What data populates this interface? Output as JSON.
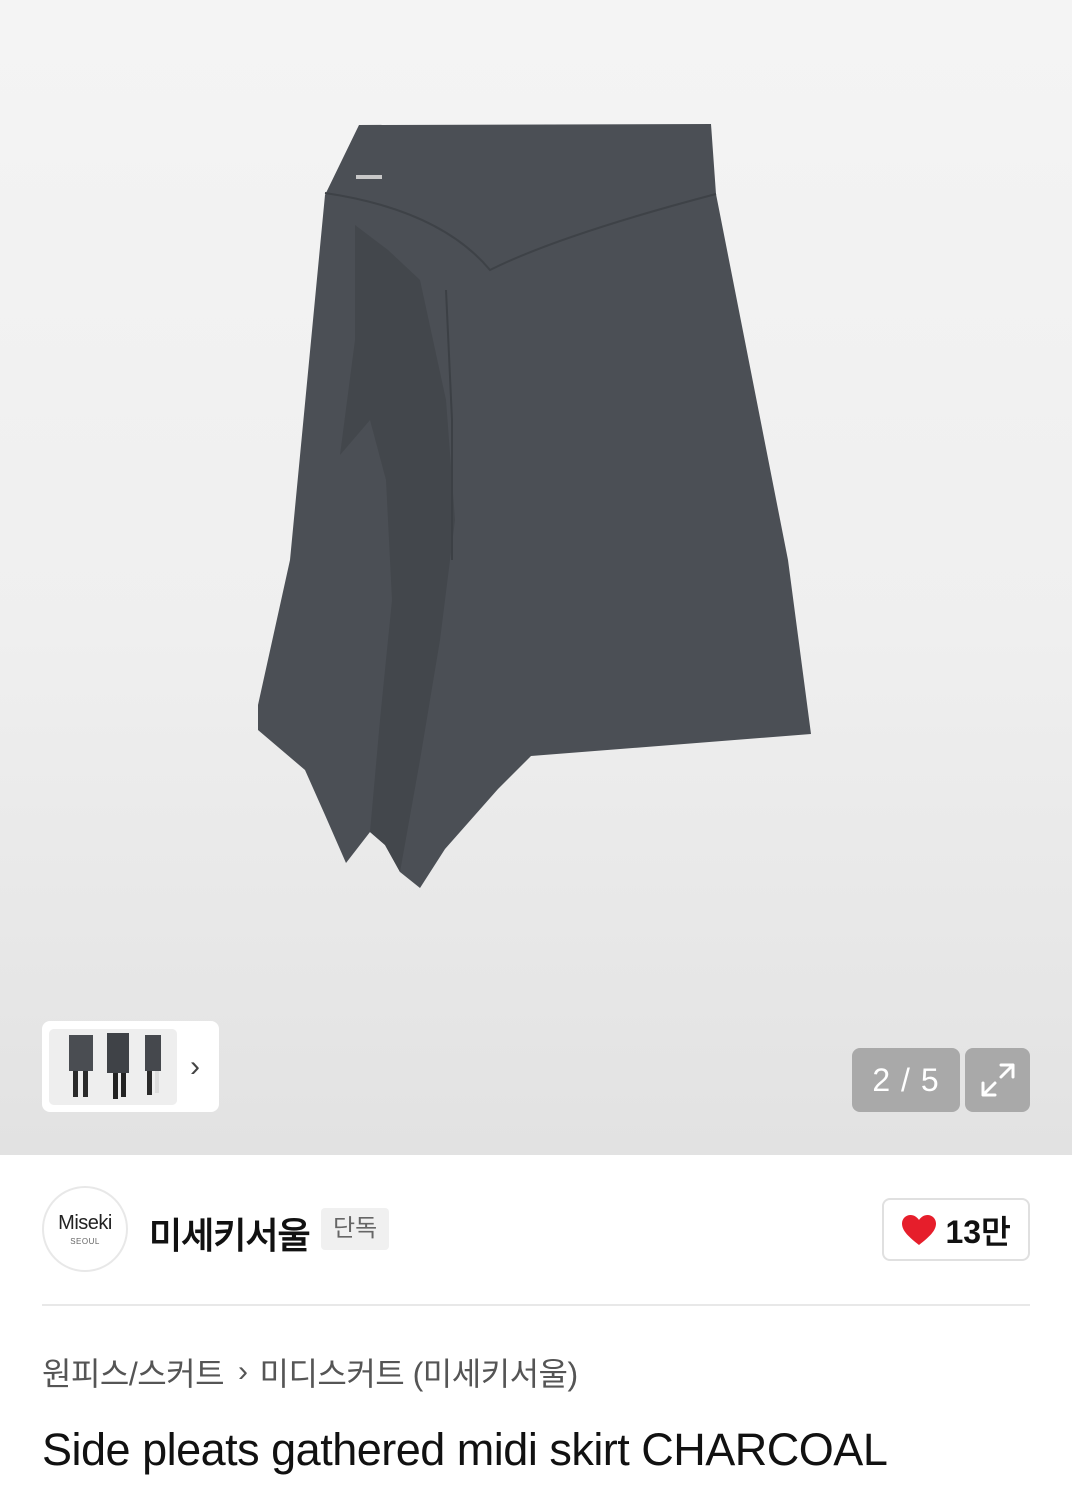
{
  "gallery": {
    "image_alt": "Charcoal asymmetric midi skirt with side pleats",
    "counter": "2 / 5",
    "thumbnails_next_icon": "chevron-right-icon",
    "expand_icon": "expand-arrows-icon",
    "product_color": "#4b4f55"
  },
  "brand": {
    "logo_main": "Miseki",
    "logo_sub": "SEOUL",
    "name": "미세키서울",
    "tag": "단독",
    "like_icon": "heart-icon",
    "like_count": "13만",
    "like_color": "#e61e2b"
  },
  "breadcrumb": {
    "category": "원피스/스커트",
    "separator_icon": "chevron-right-icon",
    "subcategory": "미디스커트 (미세키서울)"
  },
  "product": {
    "title": "Side pleats gathered midi skirt CHARCOAL"
  }
}
